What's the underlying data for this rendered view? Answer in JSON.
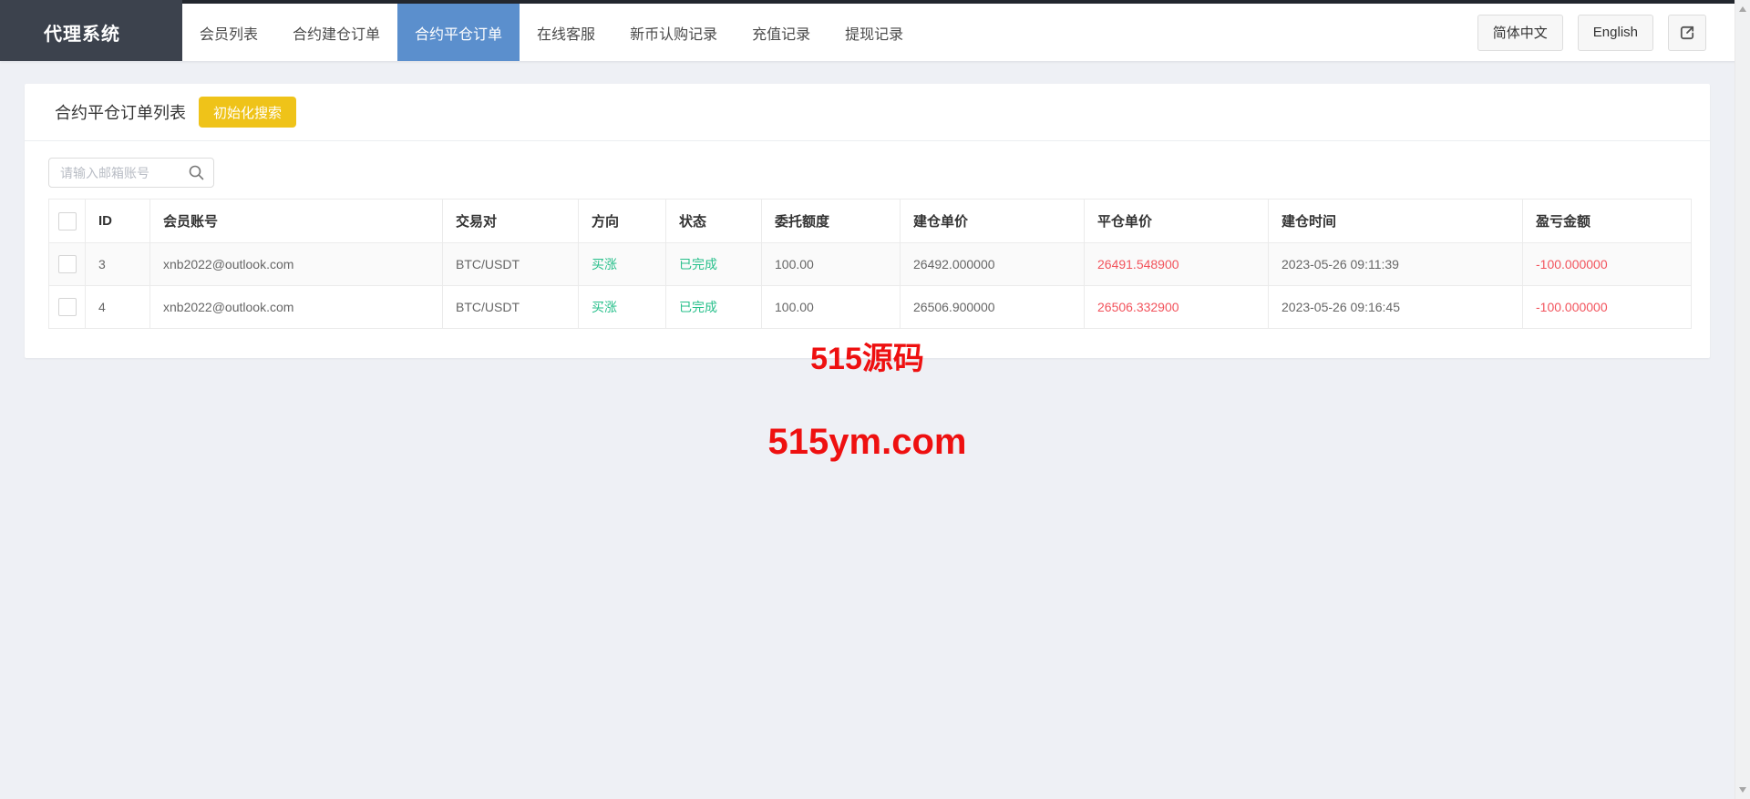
{
  "brand": "代理系统",
  "nav": {
    "items": [
      {
        "label": "会员列表",
        "active": false
      },
      {
        "label": "合约建仓订单",
        "active": false
      },
      {
        "label": "合约平仓订单",
        "active": true
      },
      {
        "label": "在线客服",
        "active": false
      },
      {
        "label": "新币认购记录",
        "active": false
      },
      {
        "label": "充值记录",
        "active": false
      },
      {
        "label": "提现记录",
        "active": false
      }
    ],
    "lang_zh": "简体中文",
    "lang_en": "English",
    "logout_icon": "export-arrow-square"
  },
  "page": {
    "title": "合约平仓订单列表",
    "init_search_button": "初始化搜索",
    "search_placeholder": "请输入邮箱账号",
    "search_icon": "magnifier"
  },
  "table": {
    "headers": [
      "ID",
      "会员账号",
      "交易对",
      "方向",
      "状态",
      "委托额度",
      "建仓单价",
      "平仓单价",
      "建仓时间",
      "盈亏金额"
    ],
    "rows": [
      {
        "id": "3",
        "account": "xnb2022@outlook.com",
        "pair": "BTC/USDT",
        "direction": "买涨",
        "status": "已完成",
        "amount": "100.00",
        "open_price": "26492.000000",
        "close_price": "26491.548900",
        "open_time": "2023-05-26 09:11:39",
        "profit": "-100.000000"
      },
      {
        "id": "4",
        "account": "xnb2022@outlook.com",
        "pair": "BTC/USDT",
        "direction": "买涨",
        "status": "已完成",
        "amount": "100.00",
        "open_price": "26506.900000",
        "close_price": "26506.332900",
        "open_time": "2023-05-26 09:16:45",
        "profit": "-100.000000"
      }
    ]
  },
  "watermark": {
    "line1": "515源码",
    "line2": "515ym.com"
  },
  "colors": {
    "top_strip": "#23272e",
    "brand_bg": "#3c424d",
    "active_tab_blue": "#5b8fcd",
    "button_yellow": "#efc319",
    "green": "#26bf8a",
    "red": "#f2535c",
    "watermark_red": "#ee1010",
    "page_bg": "#eef0f5"
  }
}
